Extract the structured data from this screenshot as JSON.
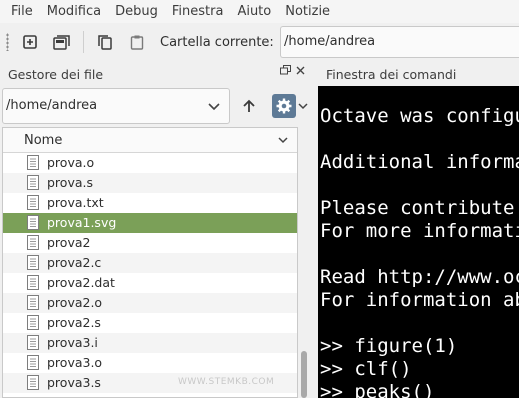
{
  "menu": [
    "File",
    "Modifica",
    "Debug",
    "Finestra",
    "Aiuto",
    "Notizie"
  ],
  "toolbar": {
    "buttons": [
      "new-script-icon",
      "new-window-icon",
      "copy-icon",
      "paste-icon"
    ],
    "cwd_label": "Cartella corrente:",
    "cwd_value": "/home/andrea"
  },
  "file_manager": {
    "title": "Gestore dei file",
    "path": "/home/andrea",
    "column_header": "Nome",
    "files": [
      {
        "name": "prova.o",
        "selected": false
      },
      {
        "name": "prova.s",
        "selected": false
      },
      {
        "name": "prova.txt",
        "selected": false
      },
      {
        "name": "prova1.svg",
        "selected": true
      },
      {
        "name": "prova2",
        "selected": false
      },
      {
        "name": "prova2.c",
        "selected": false
      },
      {
        "name": "prova2.dat",
        "selected": false
      },
      {
        "name": "prova2.o",
        "selected": false
      },
      {
        "name": "prova2.s",
        "selected": false
      },
      {
        "name": "prova3.i",
        "selected": false
      },
      {
        "name": "prova3.o",
        "selected": false
      },
      {
        "name": "prova3.s",
        "selected": false
      }
    ],
    "watermark": "WWW.STEMKB.COM"
  },
  "command_window": {
    "title": "Finestra dei comandi",
    "lines": [
      "Octave was configu",
      "",
      "Additional informa",
      "",
      "Please contribute",
      "For more informati",
      "",
      "Read http://www.oc",
      "For information ab",
      "",
      ">> figure(1)",
      ">> clf()",
      ">> peaks()"
    ]
  }
}
